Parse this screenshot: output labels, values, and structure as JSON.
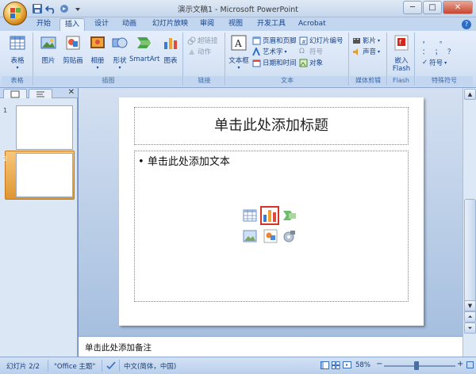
{
  "window": {
    "title": "演示文稿1 - Microsoft PowerPoint",
    "minimize": "─",
    "maximize": "□",
    "close": "✕"
  },
  "tabs": [
    "开始",
    "插入",
    "设计",
    "动画",
    "幻灯片放映",
    "审阅",
    "视图",
    "开发工具",
    "Acrobat"
  ],
  "active_tab": "插入",
  "help_label": "?",
  "ribbon": {
    "groups": {
      "tables": {
        "label": "表格",
        "buttons": [
          "表格"
        ]
      },
      "illustrations": {
        "label": "插图",
        "buttons": [
          "图片",
          "剪贴画",
          "相册",
          "形状",
          "SmartArt",
          "图表"
        ]
      },
      "links": {
        "label": "链接",
        "buttons": [
          "超链接",
          "动作"
        ]
      },
      "text": {
        "label": "文本",
        "big": "文本框",
        "small": [
          "页眉和页脚",
          "艺术字",
          "日期和时间",
          "幻灯片编号",
          "符号",
          "对象"
        ]
      },
      "media": {
        "label": "媒体剪辑",
        "buttons": [
          "影片",
          "声音"
        ]
      },
      "flash": {
        "label": "Flash",
        "big": "嵌入",
        "big2": "Flash"
      },
      "symbols": {
        "label": "特殊符号",
        "glyphs": [
          "，",
          "。",
          "：",
          "；",
          "？",
          "符号"
        ]
      }
    }
  },
  "left_pane": {
    "tab1": "",
    "tab2": "",
    "close": "✕",
    "slides": [
      {
        "num": "1"
      },
      {
        "num": "2"
      }
    ]
  },
  "slide": {
    "title_placeholder": "单击此处添加标题",
    "body_placeholder": "单击此处添加文本",
    "bullet": "•"
  },
  "notes_placeholder": "单击此处添加备注",
  "status": {
    "slide_info": "幻灯片 2/2",
    "theme": "\"Office 主题\"",
    "language": "中文(简体，中国)",
    "zoom": "58%",
    "zoom_minus": "−",
    "zoom_plus": "+"
  },
  "colors": {
    "accent": "#15428b",
    "selected": "#e09630"
  }
}
